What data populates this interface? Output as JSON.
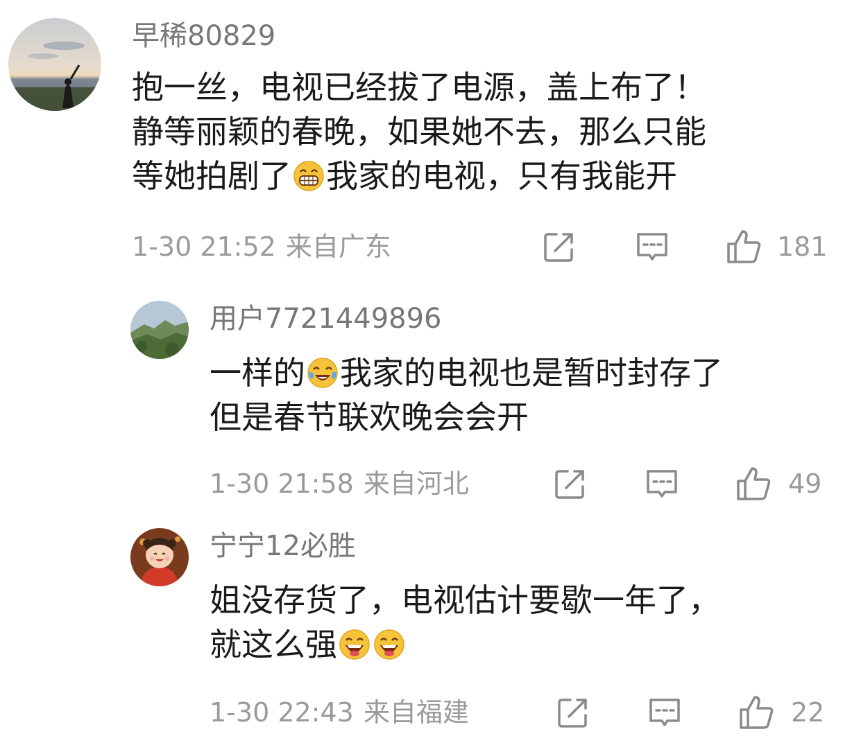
{
  "comments": [
    {
      "username": "早稀80829",
      "lines": [
        [
          "抱一丝，电视已经拔了电源，盖上布了！"
        ],
        [
          "静等丽颖的春晚，如果她不去，那么只能"
        ],
        [
          "等她拍剧了",
          "我家的电视，只有我能开"
        ]
      ],
      "time": "1-30 21:52",
      "location": "来自广东",
      "likes": "181"
    },
    {
      "username": "用户7721449896",
      "lines": [
        [
          "一样的",
          "我家的电视也是暂时封存了"
        ],
        [
          "但是春节联欢晚会会开"
        ]
      ],
      "time": "1-30 21:58",
      "location": "来自河北",
      "likes": "49"
    },
    {
      "username": "宁宁12必胜",
      "lines": [
        [
          "姐没存货了，电视估计要歇一年了，"
        ],
        [
          "就这么强"
        ]
      ],
      "time": "1-30 22:43",
      "location": "来自福建",
      "likes": "22"
    }
  ],
  "icons": {
    "share": "share-icon",
    "comment": "comment-icon",
    "like": "thumbs-up-icon",
    "emoji_grin": "grinning-face-emoji",
    "emoji_tears": "tears-of-joy-emoji",
    "emoji_laugh": "laughing-face-emoji"
  },
  "colors": {
    "username": "#777777",
    "text": "#1a1a1a",
    "meta": "#9a9a9a",
    "icon": "#8a8a8a"
  }
}
